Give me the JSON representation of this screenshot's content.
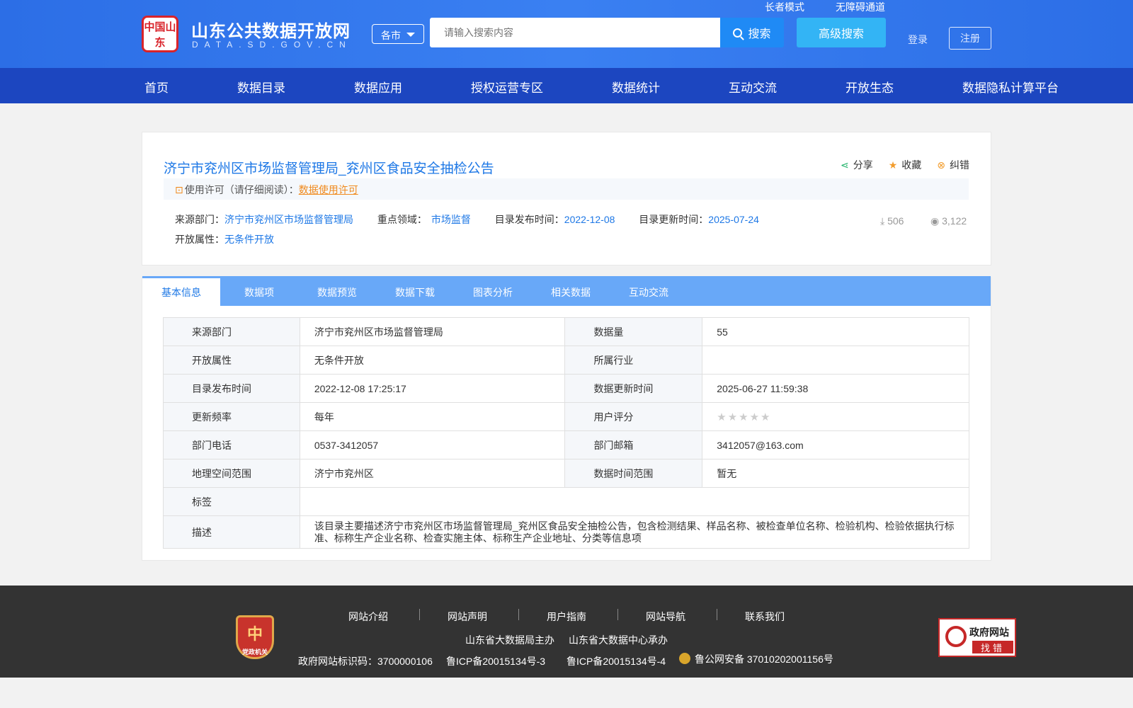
{
  "header": {
    "logo_seal": "中国山东",
    "site_title": "山东公共数据开放网",
    "site_domain": "DATA.SD.GOV.CN",
    "elder_mode": "长者模式",
    "accessibility": "无障碍通道",
    "city_select": "各市",
    "search_placeholder": "请输入搜索内容",
    "search_button": "搜索",
    "advanced_search": "高级搜索",
    "login": "登录",
    "register": "注册"
  },
  "nav": [
    "首页",
    "数据目录",
    "数据应用",
    "授权运营专区",
    "数据统计",
    "互动交流",
    "开放生态",
    "数据隐私计算平台"
  ],
  "detail": {
    "title": "济宁市兖州区市场监督管理局_兖州区食品安全抽检公告",
    "share": "分享",
    "favorite": "收藏",
    "report": "纠错",
    "license_prefix": "使用许可（请仔细阅读）：",
    "license_link": "数据使用许可",
    "source_label": "来源部门：",
    "source_value": "济宁市兖州区市场监督管理局",
    "field_label": "重点领域：",
    "field_value": "市场监督",
    "publish_label": "目录发布时间：",
    "publish_value": "2022-12-08",
    "update_label": "目录更新时间：",
    "update_value": "2025-07-24",
    "open_label": "开放属性：",
    "open_value": "无条件开放",
    "downloads": "506",
    "views": "3,122"
  },
  "tabs": [
    "基本信息",
    "数据项",
    "数据预览",
    "数据下载",
    "图表分析",
    "相关数据",
    "互动交流"
  ],
  "info_table": {
    "rows": [
      {
        "l1": "来源部门",
        "v1": "济宁市兖州区市场监督管理局",
        "l2": "数据量",
        "v2": "55"
      },
      {
        "l1": "开放属性",
        "v1": "无条件开放",
        "l2": "所属行业",
        "v2": ""
      },
      {
        "l1": "目录发布时间",
        "v1": "2022-12-08 17:25:17",
        "l2": "数据更新时间",
        "v2": "2025-06-27 11:59:38"
      },
      {
        "l1": "更新频率",
        "v1": "每年",
        "l2": "用户评分",
        "v2": ""
      },
      {
        "l1": "部门电话",
        "v1": "0537-3412057",
        "l2": "部门邮箱",
        "v2": "3412057@163.com"
      },
      {
        "l1": "地理空间范围",
        "v1": "济宁市兖州区",
        "l2": "数据时间范围",
        "v2": "暂无"
      }
    ],
    "tag_label": "标签",
    "tag_value": "",
    "desc_label": "描述",
    "desc_value": "该目录主要描述济宁市兖州区市场监督管理局_兖州区食品安全抽检公告，包含检测结果、样品名称、被检查单位名称、检验机构、检验依据执行标准、标称生产企业名称、检查实施主体、标称生产企业地址、分类等信息项",
    "rating_stars": "★★★★★"
  },
  "footer": {
    "links": [
      "网站介绍",
      "网站声明",
      "用户指南",
      "网站导航",
      "联系我们"
    ],
    "sponsor": "山东省大数据局主办",
    "organizer": "山东省大数据中心承办",
    "site_id": "政府网站标识码：3700000106",
    "icp1": "鲁ICP备20015134号-3",
    "icp2": "鲁ICP备20015134号-4",
    "police": "鲁公网安备 37010202001156号",
    "badge_top": "中",
    "badge_text": "党政机关",
    "error_badge_title": "政府网站",
    "error_badge_action": "找错"
  }
}
